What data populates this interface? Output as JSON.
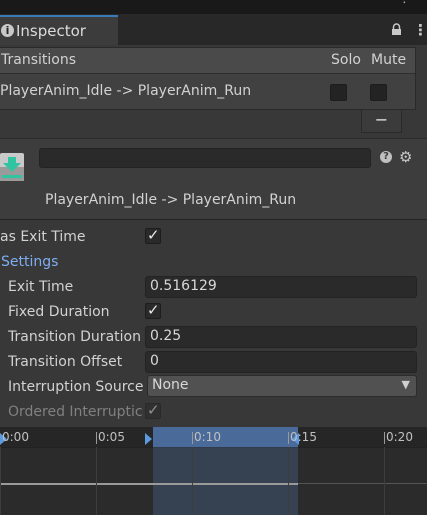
{
  "tab": {
    "label": "Inspector",
    "icon": "info-icon"
  },
  "header_icons": [
    "lock-icon",
    "kebab-menu-icon"
  ],
  "transitions_list": {
    "header": "Transitions",
    "solo_label": "Solo",
    "mute_label": "Mute",
    "rows": [
      {
        "label": "PlayerAnim_Idle -> PlayerAnim_Run",
        "solo": false,
        "mute": false
      }
    ],
    "remove_label": "−"
  },
  "transition": {
    "title": "PlayerAnim_Idle -> PlayerAnim_Run",
    "name_value": "",
    "icons": [
      "transition-icon",
      "help-icon",
      "settings-gear-icon"
    ]
  },
  "properties": {
    "has_exit_time_label": "as Exit Time",
    "has_exit_time": true,
    "settings_label": "Settings",
    "exit_time_label": "Exit Time",
    "exit_time_value": "0.516129",
    "fixed_duration_label": "Fixed Duration",
    "fixed_duration": true,
    "transition_duration_label": "Transition Duration",
    "transition_duration_value": "0.25",
    "transition_offset_label": "Transition Offset",
    "transition_offset_value": "0",
    "interruption_source_label": "Interruption Source",
    "interruption_source_value": "None",
    "ordered_interruption_label": "Ordered Interruptic",
    "ordered_interruption": true
  },
  "timeline": {
    "labels": [
      "0:00",
      "0:05",
      "0:10",
      "0:15",
      "0:20"
    ],
    "accent_color": "#4a6a9a"
  }
}
